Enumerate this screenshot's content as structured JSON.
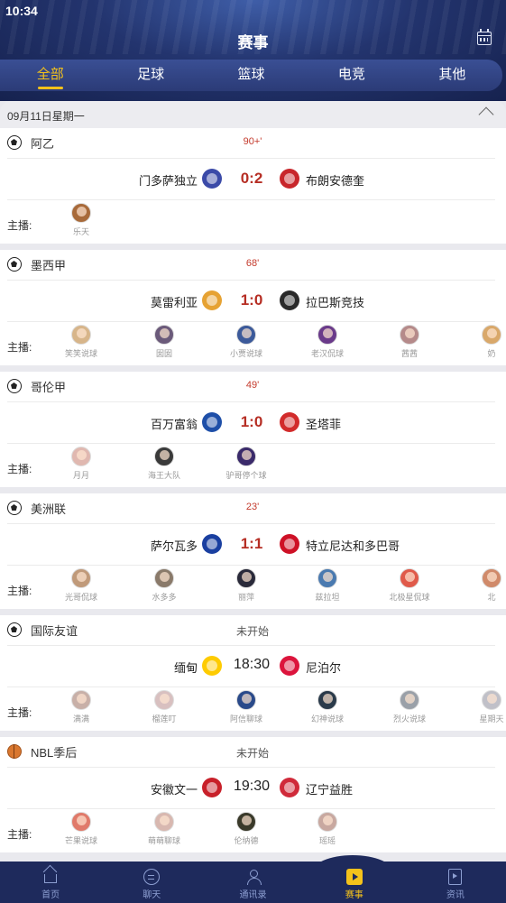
{
  "status_bar": {
    "time": "10:34"
  },
  "header": {
    "title": "赛事",
    "calendar_icon": "calendar-icon"
  },
  "tabs": [
    {
      "label": "全部",
      "active": true
    },
    {
      "label": "足球",
      "active": false
    },
    {
      "label": "篮球",
      "active": false
    },
    {
      "label": "电竞",
      "active": false
    },
    {
      "label": "其他",
      "active": false
    }
  ],
  "date_bar": {
    "date": "09月11日星期一",
    "collapse_icon": "chevron-up-icon"
  },
  "anchor_label": "主播:",
  "matches": [
    {
      "sport": "soccer",
      "league": "阿乙",
      "status": "90+'",
      "live": true,
      "home": "门多萨独立",
      "score": "0:2",
      "away": "布朗安德奎",
      "home_logo_color": "#3b4aa8",
      "away_logo_color": "#c8262b",
      "anchors": [
        {
          "name": "乐天",
          "color": "#a86a3a"
        }
      ]
    },
    {
      "sport": "soccer",
      "league": "墨西甲",
      "status": "68'",
      "live": true,
      "home": "莫雷利亚",
      "score": "1:0",
      "away": "拉巴斯竞技",
      "home_logo_color": "#e6a233",
      "away_logo_color": "#2a2a2a",
      "anchors": [
        {
          "name": "笑笑说球",
          "color": "#d7b58a"
        },
        {
          "name": "囡囡",
          "color": "#6b5a7a"
        },
        {
          "name": "小贾说球",
          "color": "#3c5a9a"
        },
        {
          "name": "老汉侃球",
          "color": "#6a3a8a"
        },
        {
          "name": "茜茜",
          "color": "#b58a8a"
        },
        {
          "name": "奶",
          "color": "#d9a86a"
        }
      ]
    },
    {
      "sport": "soccer",
      "league": "哥伦甲",
      "status": "49'",
      "live": true,
      "home": "百万富翁",
      "score": "1:0",
      "away": "圣塔菲",
      "home_logo_color": "#1e4fa8",
      "away_logo_color": "#d22b2b",
      "anchors": [
        {
          "name": "月月",
          "color": "#e0b8b0"
        },
        {
          "name": "海王大队",
          "color": "#3a3a3a"
        },
        {
          "name": "驴哥停个球",
          "color": "#3a2a6a"
        }
      ]
    },
    {
      "sport": "soccer",
      "league": "美洲联",
      "status": "23'",
      "live": true,
      "home": "萨尔瓦多",
      "score": "1:1",
      "away": "特立尼达和多巴哥",
      "home_logo_color": "#1a3fa0",
      "away_logo_color": "#ce1126",
      "anchors": [
        {
          "name": "光哥侃球",
          "color": "#c09a7a"
        },
        {
          "name": "水多多",
          "color": "#8a7a6a"
        },
        {
          "name": "丽萍",
          "color": "#2a2a3a"
        },
        {
          "name": "兹拉坦",
          "color": "#4a7ab0"
        },
        {
          "name": "北极星侃球",
          "color": "#e05a4a"
        },
        {
          "name": "北",
          "color": "#d08a6a"
        }
      ]
    },
    {
      "sport": "soccer",
      "league": "国际友谊",
      "status": "未开始",
      "live": false,
      "home": "缅甸",
      "score": "18:30",
      "away": "尼泊尔",
      "home_logo_color": "#fecb00",
      "away_logo_color": "#dc143c",
      "anchors": [
        {
          "name": "满满",
          "color": "#c8b0a8"
        },
        {
          "name": "榴莲叮",
          "color": "#d8c0c0"
        },
        {
          "name": "阿信聊球",
          "color": "#2a4a8a"
        },
        {
          "name": "幻神说球",
          "color": "#2a3a4a"
        },
        {
          "name": "烈火说球",
          "color": "#9aa0a8"
        },
        {
          "name": "星期天",
          "color": "#c0c0c8"
        }
      ]
    },
    {
      "sport": "basketball",
      "league": "NBL季后",
      "status": "未开始",
      "live": false,
      "home": "安徽文一",
      "score": "19:30",
      "away": "辽宁益胜",
      "home_logo_color": "#c8202a",
      "away_logo_color": "#d02a3a",
      "anchors": [
        {
          "name": "芒果说球",
          "color": "#e07a6a"
        },
        {
          "name": "萌萌聊球",
          "color": "#d8b8b0"
        },
        {
          "name": "伦纳德",
          "color": "#3a3a2a"
        },
        {
          "name": "瑶瑶",
          "color": "#c8a8a0"
        }
      ]
    }
  ],
  "nav": [
    {
      "label": "首页",
      "icon": "home-icon",
      "active": false
    },
    {
      "label": "聊天",
      "icon": "chat-icon",
      "active": false
    },
    {
      "label": "通讯录",
      "icon": "contacts-icon",
      "active": false
    },
    {
      "label": "赛事",
      "icon": "match-icon",
      "active": true
    },
    {
      "label": "资讯",
      "icon": "news-icon",
      "active": false
    }
  ]
}
